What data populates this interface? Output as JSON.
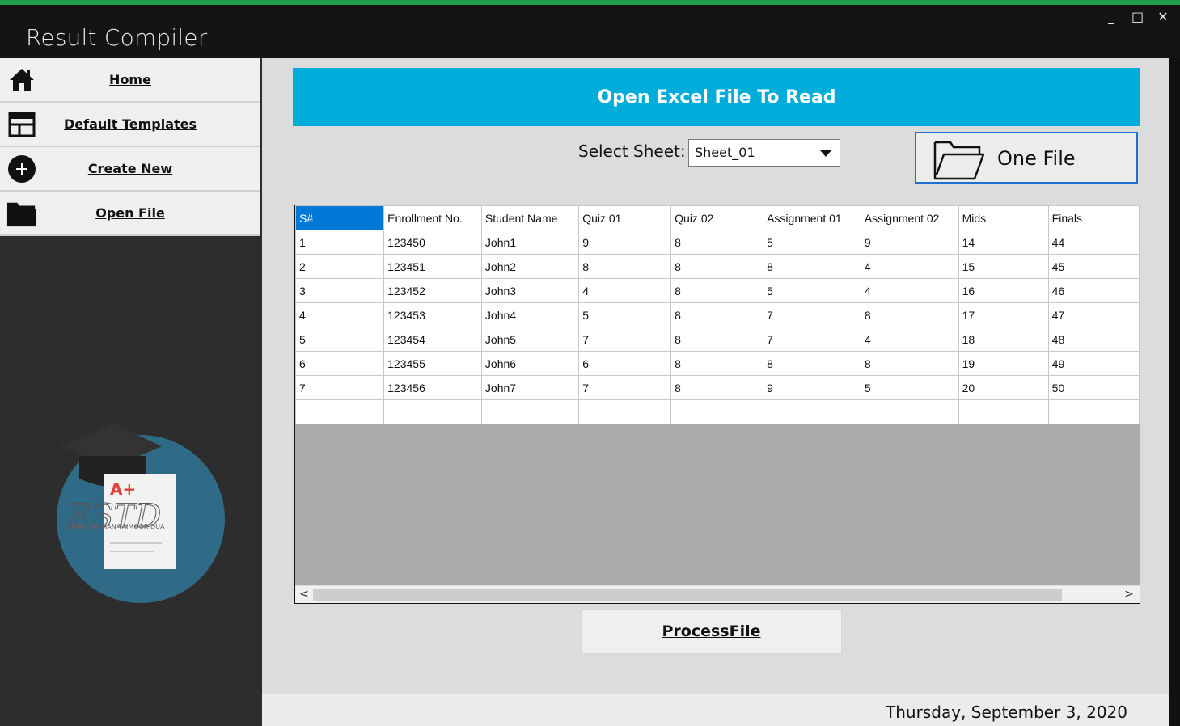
{
  "window": {
    "title": "Result Compiler",
    "controls": {
      "minimize": "_",
      "maximize": "□",
      "close": "✕"
    }
  },
  "sidebar": {
    "items": [
      {
        "label": "Home",
        "icon": "home-icon"
      },
      {
        "label": "Default Templates",
        "icon": "templates-icon"
      },
      {
        "label": "Create New",
        "icon": "plus-circle-icon"
      },
      {
        "label": "Open File",
        "icon": "folder-icon"
      }
    ],
    "logo": {
      "badge": "A+",
      "text": "ESTD",
      "subtext": "EBBAD SALMAN  TAIMOOR DUA"
    }
  },
  "main": {
    "banner": "Open Excel File To Read",
    "sheet_label": "Select Sheet:",
    "sheet_value": "Sheet_01",
    "one_file_label": "One File",
    "process_label": "ProcessFile",
    "grid": {
      "columns": [
        "S#",
        "Enrollment No.",
        "Student Name",
        "Quiz 01",
        "Quiz 02",
        "Assignment 01",
        "Assignment 02",
        "Mids",
        "Finals"
      ],
      "rows": [
        [
          "1",
          "123450",
          "John1",
          "9",
          "8",
          "5",
          "9",
          "14",
          "44"
        ],
        [
          "2",
          "123451",
          "John2",
          "8",
          "8",
          "8",
          "4",
          "15",
          "45"
        ],
        [
          "3",
          "123452",
          "John3",
          "4",
          "8",
          "5",
          "4",
          "16",
          "46"
        ],
        [
          "4",
          "123453",
          "John4",
          "5",
          "8",
          "7",
          "8",
          "17",
          "47"
        ],
        [
          "5",
          "123454",
          "John5",
          "7",
          "8",
          "7",
          "4",
          "18",
          "48"
        ],
        [
          "6",
          "123455",
          "John6",
          "6",
          "8",
          "8",
          "8",
          "19",
          "49"
        ],
        [
          "7",
          "123456",
          "John7",
          "7",
          "8",
          "9",
          "5",
          "20",
          "50"
        ]
      ]
    },
    "scroll": {
      "left": "<",
      "right": ">"
    }
  },
  "status": {
    "date": "Thursday, September 3, 2020"
  },
  "colors": {
    "accent": "#00acd9",
    "stripe": "#1e9e49",
    "selected": "#0078d7"
  }
}
